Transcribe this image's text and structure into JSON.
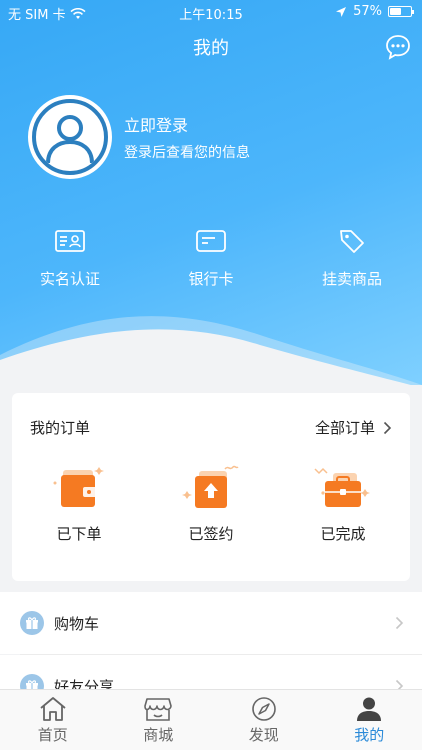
{
  "status_bar": {
    "carrier": "无 SIM 卡",
    "time": "上午10:15",
    "battery": "57%",
    "battery_level": 0.57
  },
  "header": {
    "title": "我的"
  },
  "profile": {
    "login_label": "立即登录",
    "login_hint": "登录后查看您的信息"
  },
  "quick_actions": [
    {
      "label": "实名认证",
      "icon": "id-card-icon"
    },
    {
      "label": "银行卡",
      "icon": "bank-card-icon"
    },
    {
      "label": "挂卖商品",
      "icon": "tag-icon"
    }
  ],
  "orders": {
    "title": "我的订单",
    "all_label": "全部订单",
    "items": [
      {
        "label": "已下单",
        "icon": "wallet-icon"
      },
      {
        "label": "已签约",
        "icon": "signed-box-icon"
      },
      {
        "label": "已完成",
        "icon": "briefcase-icon"
      }
    ]
  },
  "menu": [
    {
      "label": "购物车",
      "icon": "gift-icon"
    },
    {
      "label": "好友分享",
      "icon": "gift-icon"
    }
  ],
  "tabs": [
    {
      "label": "首页",
      "icon": "home-icon",
      "active": false
    },
    {
      "label": "商城",
      "icon": "store-icon",
      "active": false
    },
    {
      "label": "发现",
      "icon": "compass-icon",
      "active": false
    },
    {
      "label": "我的",
      "icon": "person-icon",
      "active": true
    }
  ],
  "colors": {
    "hero_blue": "#36a8f5",
    "accent_orange": "#f57a22",
    "active_tab": "#2b8ad8"
  }
}
